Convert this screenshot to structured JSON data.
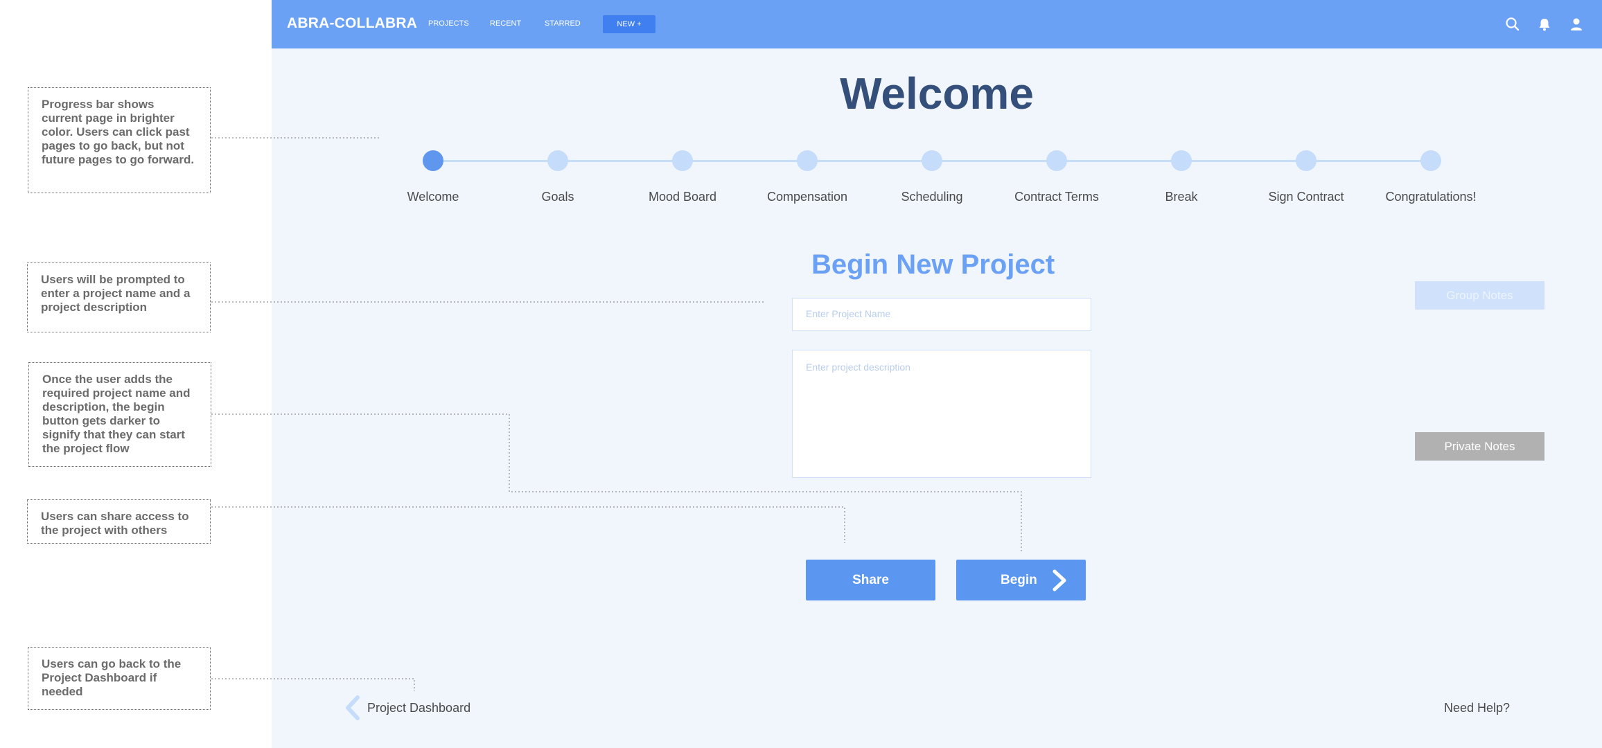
{
  "topbar": {
    "brand": "ABRA-COLLABRA",
    "nav": [
      "PROJECTS",
      "RECENT",
      "STARRED"
    ],
    "new_button": "NEW +",
    "icons": [
      "search-icon",
      "bell-icon",
      "user-icon"
    ],
    "color": "#6aa1f4"
  },
  "main": {
    "title": "Welcome",
    "subtitle": "Begin New Project",
    "name_placeholder": "Enter Project Name",
    "description_placeholder": "Enter project description",
    "share_label": "Share",
    "begin_label": "Begin",
    "dashboard_link": "Project Dashboard",
    "need_help": "Need Help?"
  },
  "progress": {
    "current_step": 0,
    "steps": [
      "Welcome",
      "Goals",
      "Mood Board",
      "Compensation",
      "Scheduling",
      "Contract Terms",
      "Break",
      "Sign Contract",
      "Congratulations!"
    ],
    "active_color": "#5f97ef",
    "inactive_color": "#c5dcfa"
  },
  "side": {
    "group_notes": "Group Notes",
    "private_notes": "Private Notes"
  },
  "annotations": [
    "Progress bar shows current page in brighter color. Users can click past pages to go back, but not future pages to go forward.",
    "Users will be prompted to enter a project name and a project description",
    "Once the user adds the required project name and description, the begin button gets darker to signify that they can start the project flow",
    "Users can share access to the project with others",
    "Users can go back to the Project Dashboard if needed"
  ]
}
